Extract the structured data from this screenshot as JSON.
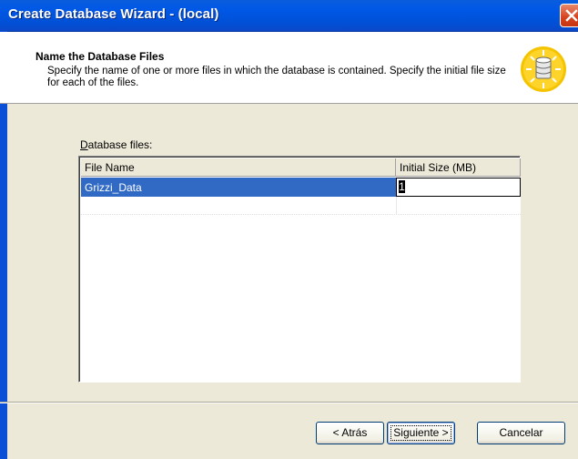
{
  "window": {
    "title": "Create Database Wizard - (local)"
  },
  "header": {
    "title": "Name the Database Files",
    "description": "Specify the name of one or more files in which the database is contained. Specify the initial file size for each of the files.",
    "icon": "database-wizard-icon"
  },
  "files": {
    "label_prefix": "D",
    "label_rest": "atabase files:",
    "columns": [
      "File Name",
      "Initial Size (MB)"
    ],
    "rows": [
      {
        "name": "Grizzi_Data",
        "size": "1"
      }
    ]
  },
  "buttons": {
    "back": "< Atrás",
    "next": "Siguiente >",
    "cancel": "Cancelar"
  },
  "colors": {
    "titlebar": "#0058e6",
    "selection": "#316ac5",
    "dialog_bg": "#ece9d8"
  }
}
